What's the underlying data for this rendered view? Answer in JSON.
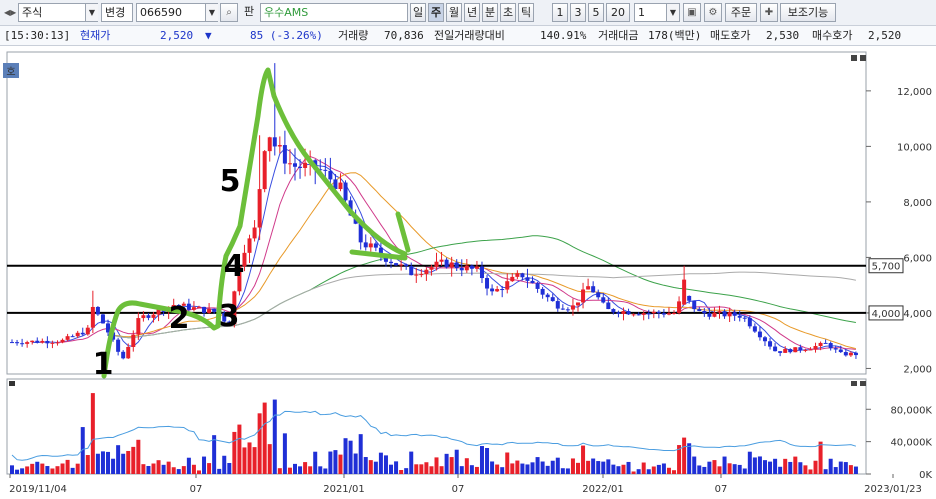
{
  "toolbar": {
    "market": "주식",
    "change_mode": "변경",
    "code": "066590",
    "edit_label": "판",
    "stock_name": "우수AMS",
    "period_tabs": [
      "일",
      "주",
      "월",
      "년",
      "분",
      "초",
      "틱"
    ],
    "active_period": "주",
    "interval_buttons": [
      "1",
      "3",
      "5",
      "20"
    ],
    "interval_value": "1",
    "order_label": "주문",
    "aux_label": "보조기능"
  },
  "info": {
    "time": "[15:30:13]",
    "price_label": "현재가",
    "price": "2,520",
    "change_arrow": "▼",
    "change": "85 (-3.26%)",
    "volume_label": "거래량",
    "volume": "70,836",
    "prev_ratio_label": "전일거래량대비",
    "prev_ratio": "140.91%",
    "amount_label": "거래대금",
    "amount": "178(백만)",
    "ask_label": "매도호가",
    "ask": "2,530",
    "bid_label": "매수호가",
    "bid": "2,520"
  },
  "chart_data": {
    "type": "candlestick",
    "y_ticks": [
      "12,000",
      "10,000",
      "8,000",
      "6,000",
      "4,000",
      "2,000"
    ],
    "y_range": [
      1800,
      13400
    ],
    "hlines": [
      {
        "value": 5700,
        "label": "5,700"
      },
      {
        "value": 4000,
        "label": "4,000"
      }
    ],
    "x_labels": [
      "2019/11/04",
      "07",
      "2021/01",
      "07",
      "2022/01",
      "07",
      "2023/01/23"
    ],
    "annotations": [
      "1",
      "2",
      "3",
      "4",
      "5"
    ],
    "volume_ticks": [
      "80,000K",
      "40,000K",
      "0K"
    ],
    "volume_range": [
      0,
      110000
    ],
    "corner_label": "호",
    "colors": {
      "up": "#e8202a",
      "down": "#1f2fd6",
      "wave": "#6cbf3a",
      "ma_green": "#3ca24a",
      "ma_orange": "#e89a2a",
      "ma_blue": "#3a4ee0",
      "volume_ma": "#4a9de0"
    }
  }
}
